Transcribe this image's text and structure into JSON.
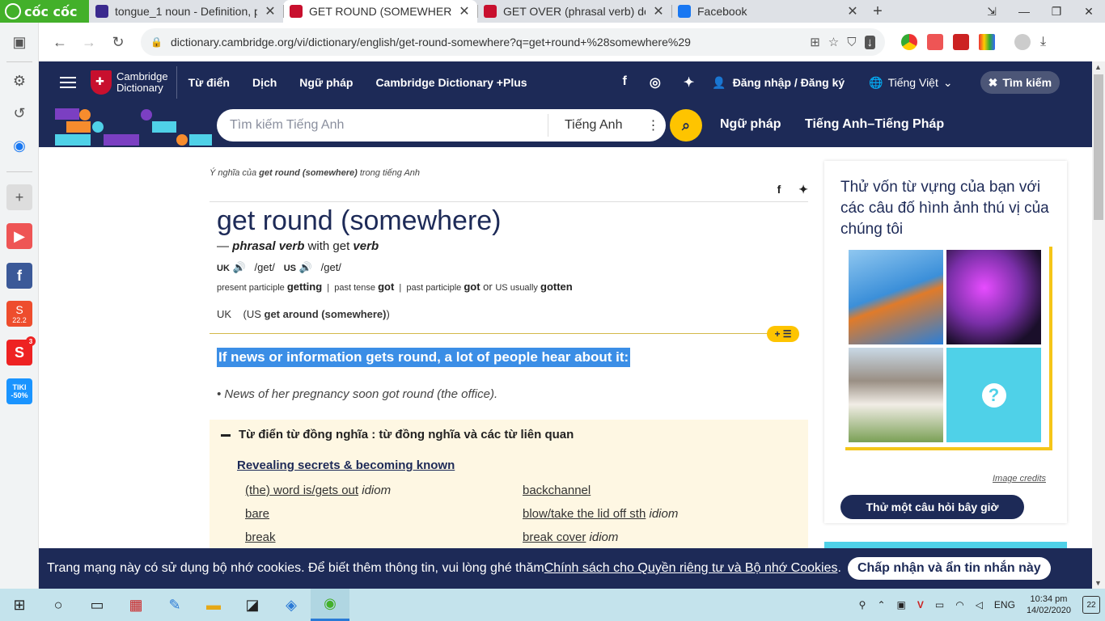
{
  "browser": {
    "brand": "cốc cốc",
    "tabs": [
      {
        "title": "tongue_1 noun - Definition, p",
        "color": "#3b2a8e"
      },
      {
        "title": "GET ROUND (SOMEWHERE) |",
        "color": "#c8102e"
      },
      {
        "title": "GET OVER (phrasal verb) defi",
        "color": "#c8102e"
      },
      {
        "title": "Facebook",
        "color": "#1877f2"
      }
    ],
    "url": "dictionary.cambridge.org/vi/dictionary/english/get-round-somewhere?q=get+round+%28somewhere%29"
  },
  "sidebar": {
    "shopee_label": "22.2",
    "tiki_label": "TIKI -50%",
    "badge_count": "3"
  },
  "header": {
    "logo_line1": "Cambridge",
    "logo_line2": "Dictionary",
    "nav": [
      "Từ điển",
      "Dịch",
      "Ngữ pháp",
      "Cambridge Dictionary +Plus"
    ],
    "login": "Đăng nhập / Đăng ký",
    "language": "Tiếng Việt",
    "search_button": "Tìm kiếm"
  },
  "search": {
    "placeholder": "Tìm kiếm Tiếng Anh",
    "dictionary": "Tiếng Anh",
    "link1": "Ngữ pháp",
    "link2": "Tiếng Anh–Tiếng Pháp"
  },
  "entry": {
    "breadcrumb_pre": "Ý nghĩa của ",
    "breadcrumb_word": "get round (somewhere)",
    "breadcrumb_post": " trong tiếng Anh",
    "headword": "get round (somewhere)",
    "pos_dash": "— ",
    "pos": "phrasal verb",
    "pos_with": " with get ",
    "pos_verb": "verb",
    "uk_label": "UK",
    "uk_ipa": "/get/",
    "us_label": "US",
    "us_ipa": "/get/",
    "pp_label": "present participle",
    "pp": "getting",
    "pt_label": "past tense",
    "pt": "got",
    "past_p_label": "past participle",
    "past_p": "got",
    "or_text": " or ",
    "us_usually": "US usually",
    "gotten": "gotten",
    "var_uk": "UK",
    "var_open": "(US ",
    "variant": "get around (somewhere)",
    "var_close": ")",
    "definition": "If news or information gets round, a lot of people hear about it:",
    "example": "News of her pregnancy soon got round (the office)."
  },
  "thesaurus": {
    "heading": "Từ điển từ đồng nghĩa : từ đồng nghĩa và các từ liên quan",
    "category": "Revealing secrets & becoming known",
    "col1": [
      {
        "text": "(the) word is/gets out",
        "tag": "idiom"
      },
      {
        "text": "bare",
        "tag": ""
      },
      {
        "text": "break",
        "tag": ""
      }
    ],
    "col2": [
      {
        "text": "backchannel",
        "tag": ""
      },
      {
        "text": "blow/take the lid off sth",
        "tag": "idiom"
      },
      {
        "text": "break cover",
        "tag": "idiom"
      }
    ]
  },
  "quiz": {
    "title": "Thử vốn từ vựng của bạn với các câu đố hình ảnh thú vị của chúng tôi",
    "credits": "Image credits",
    "button": "Thử một câu hỏi bây giờ",
    "mystery": "?"
  },
  "cookie": {
    "text": "Trang mạng này có sử dụng bộ nhớ cookies. Để biết thêm thông tin, vui lòng ghé thăm ",
    "link": "Chính sách cho Quyền riêng tư và Bộ nhớ Cookies",
    "period": ".",
    "accept": "Chấp nhận và ẩn tin nhắn này"
  },
  "taskbar": {
    "lang": "ENG",
    "time": "10:34 pm",
    "date": "14/02/2020",
    "notifications": "22"
  },
  "colors": {
    "navy": "#1d2a57",
    "yellow": "#fec400",
    "highlight": "#3b8ee6",
    "thesaurus_bg": "#fef7e3"
  }
}
